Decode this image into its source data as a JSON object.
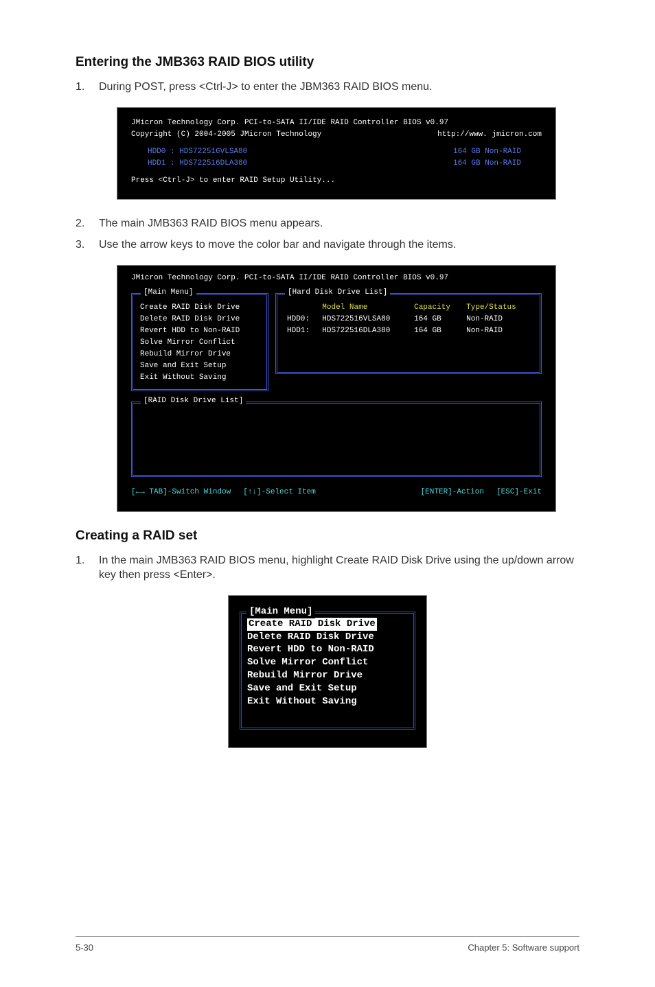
{
  "section1": {
    "heading": "Entering the JMB363 RAID BIOS utility",
    "step1_num": "1.",
    "step1_txt": "During POST, press <Ctrl-J> to enter the JBM363 RAID BIOS menu."
  },
  "bios1": {
    "line1_left": "JMicron Technology Corp. PCI-to-SATA II/IDE RAID Controller BIOS v0.97",
    "line2_left": "Copyright (C) 2004-2005 JMicron Technology",
    "line2_right": "http://www. jmicron.com",
    "hdd0_left": "HDD0 : HDS722516VLSA80",
    "hdd0_right": "164 GB Non-RAID",
    "hdd1_left": "HDD1 : HDS722516DLA380",
    "hdd1_right": "164 GB Non-RAID",
    "prompt": "Press <Ctrl-J> to enter RAID Setup Utility..."
  },
  "mid": {
    "step2_num": "2.",
    "step2_txt": "The main JMB363 RAID BIOS menu appears.",
    "step3_num": "3.",
    "step3_txt": "Use the arrow keys to move the color bar and navigate through the items."
  },
  "bios2": {
    "title": "JMicron Technology Corp. PCI-to-SATA II/IDE RAID Controller BIOS v0.97",
    "main_menu_label": "[Main Menu]",
    "hard_disk_label": "[Hard Disk Drive List]",
    "raid_disk_label": "[RAID Disk Drive List]",
    "menu_items": [
      "Create RAID Disk Drive",
      "Delete RAID Disk Drive",
      "Revert HDD to Non-RAID",
      "Solve Mirror Conflict",
      "Rebuild Mirror Drive",
      "Save and Exit Setup",
      "Exit Without Saving"
    ],
    "disk_header": {
      "model": "Model Name",
      "capacity": "Capacity",
      "type": "Type/Status"
    },
    "disks": [
      {
        "slot": "HDD0:",
        "model": "HDS722516VLSA80",
        "cap": "164 GB",
        "type": "Non-RAID"
      },
      {
        "slot": "HDD1:",
        "model": "HDS722516DLA380",
        "cap": "164 GB",
        "type": "Non-RAID"
      }
    ],
    "footer": {
      "tab": "[←→ TAB]-Switch Window",
      "sel": "[↑↓]-Select Item",
      "ent": "[ENTER]-Action",
      "esc": "[ESC]-Exit"
    }
  },
  "section2": {
    "heading": "Creating a RAID set",
    "step1_num": "1.",
    "step1_txt": "In the main JMB363 RAID BIOS menu, highlight Create RAID Disk Drive using the up/down arrow key then press <Enter>."
  },
  "bios3": {
    "label": "[Main Menu]",
    "items": [
      "Create RAID Disk Drive",
      "Delete RAID Disk Drive",
      "Revert HDD to Non-RAID",
      "Solve Mirror Conflict",
      "Rebuild Mirror Drive",
      "Save and Exit Setup",
      "Exit Without Saving"
    ]
  },
  "footer": {
    "left": "5-30",
    "right": "Chapter 5: Software support"
  }
}
